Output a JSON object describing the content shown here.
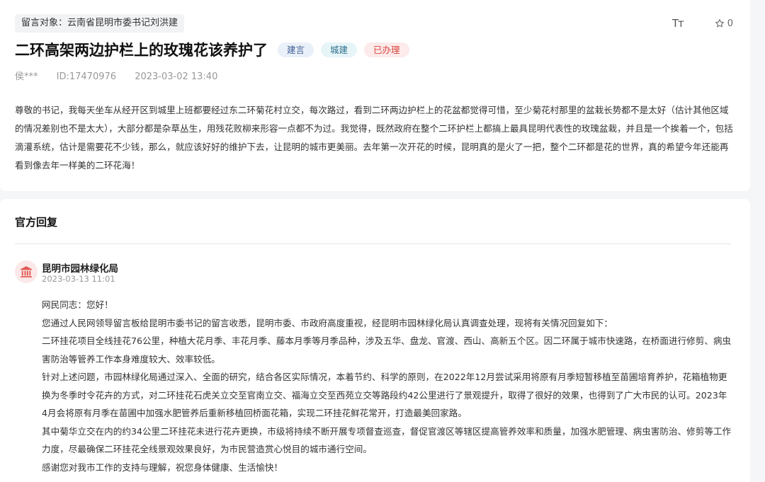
{
  "post": {
    "target_label": "留言对象：云南省昆明市委书记刘洪建",
    "font_size_icon": "Tт",
    "favorite_count": "0",
    "title": "二环高架两边护栏上的玫瑰花该养护了",
    "tags": [
      "建言",
      "城建",
      "已办理"
    ],
    "author": "侯***",
    "id": "ID:17470976",
    "time": "2023-03-02 13:40",
    "body": "尊敬的书记，我每天坐车从经开区到城里上班都要经过东二环菊花村立交，每次路过，看到二环两边护栏上的花盆都觉得可惜，至少菊花村那里的盆栽长势都不是太好（估计其他区域的情况差别也不是太大），大部分都是杂草丛生，用残花败柳来形容一点都不为过。我觉得，既然政府在整个二环护栏上都搞上最具昆明代表性的玫瑰盆栽，并且是一个挨着一个，包括滴灌系统，估计是需要花不少钱，那么，就应该好好的维护下去，让昆明的城市更美丽。去年第一次开花的时候，昆明真的是火了一把，整个二环都是花的世界，真的希望今年还能再看到像去年一样美的二环花海！"
  },
  "reply": {
    "section_title": "官方回复",
    "org_name": "昆明市园林绿化局",
    "time": "2023-03-13 11:01",
    "paragraphs": [
      "网民同志：您好！",
      "您通过人民网领导留言板给昆明市委书记的留言收悉，昆明市委、市政府高度重视，经昆明市园林绿化局认真调查处理，现将有关情况回复如下：",
      "二环挂花项目全线挂花76公里，种植大花月季、丰花月季、藤本月季等月季品种，涉及五华、盘龙、官渡、西山、高新五个区。因二环属于城市快速路，在桥面进行修剪、病虫害防治等管养工作本身难度较大、效率较低。",
      "针对上述问题，市园林绿化局通过深入、全面的研究，结合各区实际情况，本着节约、科学的原则，在2022年12月尝试采用将原有月季短暂移植至苗圃培育养护，花箱植物更换为冬季时令花卉的方式，对二环挂花石虎关立交至官南立交、福海立交至西苑立交等路段约42公里进行了景观提升，取得了很好的效果，也得到了广大市民的认可。2023年4月会将原有月季在苗圃中加强水肥管养后重新移植回桥面花箱，实现二环挂花鲜花常开，打造最美回家路。",
      "其中菊华立交在内的约34公里二环挂花未进行花卉更换，市级将持续不断开展专项督查巡查，督促官渡区等辖区提高管养效率和质量，加强水肥管理、病虫害防治、修剪等工作力度，尽最确保二环挂花全线景观效果良好，为市民营造赏心悦目的城市通行空间。",
      "感谢您对我市工作的支持与理解，祝您身体健康、生活愉快！"
    ]
  },
  "icons": {
    "star": "star-outline-icon",
    "font_size": "font-size-icon",
    "org": "government-building-icon"
  },
  "colors": {
    "tag_blue_bg": "#eaf0f9",
    "tag_red_text": "#d8463e",
    "org_icon": "#e05a55"
  }
}
